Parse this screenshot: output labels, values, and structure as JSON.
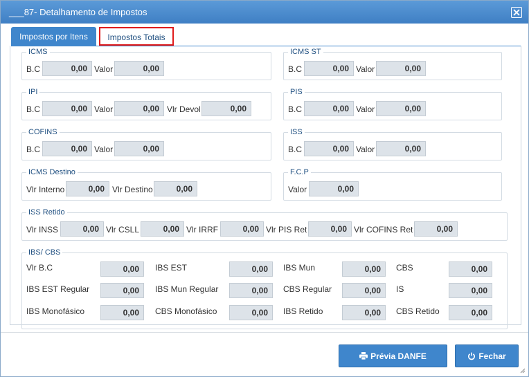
{
  "window": {
    "title": "___87- Detalhamento de Impostos"
  },
  "tabs": [
    {
      "label": "Impostos por Itens",
      "active": true
    },
    {
      "label": "Impostos Totais",
      "active": false
    }
  ],
  "labels": {
    "bc": "B.C",
    "valor": "Valor",
    "vlr_devol": "Vlr Devol"
  },
  "icms": {
    "title": "ICMS",
    "bc": "0,00",
    "valor": "0,00"
  },
  "icms_st": {
    "title": "ICMS ST",
    "bc": "0,00",
    "valor": "0,00"
  },
  "ipi": {
    "title": "IPI",
    "bc": "0,00",
    "valor": "0,00",
    "vlr_devol": "0,00"
  },
  "pis": {
    "title": "PIS",
    "bc": "0,00",
    "valor": "0,00"
  },
  "cofins": {
    "title": "COFINS",
    "bc": "0,00",
    "valor": "0,00"
  },
  "iss": {
    "title": "ISS",
    "bc": "0,00",
    "valor": "0,00"
  },
  "icms_destino": {
    "title": "ICMS Destino",
    "vlr_interno_label": "Vlr Interno",
    "vlr_interno": "0,00",
    "vlr_destino_label": "Vlr Destino",
    "vlr_destino": "0,00"
  },
  "fcp": {
    "title": "F.C.P",
    "valor_label": "Valor",
    "valor": "0,00"
  },
  "iss_retido": {
    "title": "ISS Retido",
    "fields": [
      {
        "label": "Vlr INSS",
        "value": "0,00"
      },
      {
        "label": "Vlr CSLL",
        "value": "0,00"
      },
      {
        "label": "Vlr IRRF",
        "value": "0,00"
      },
      {
        "label": "Vlr PIS Ret",
        "value": "0,00"
      },
      {
        "label": "Vlr COFINS Ret",
        "value": "0,00"
      }
    ]
  },
  "ibs_cbs": {
    "title": "IBS/ CBS",
    "fields": [
      {
        "label": "Vlr B.C",
        "value": "0,00"
      },
      {
        "label": "IBS EST",
        "value": "0,00"
      },
      {
        "label": "IBS Mun",
        "value": "0,00"
      },
      {
        "label": "CBS",
        "value": "0,00"
      },
      {
        "label": "IBS EST Regular",
        "value": "0,00"
      },
      {
        "label": "IBS Mun Regular",
        "value": "0,00"
      },
      {
        "label": "CBS Regular",
        "value": "0,00"
      },
      {
        "label": "IS",
        "value": "0,00"
      },
      {
        "label": "IBS Monofásico",
        "value": "0,00"
      },
      {
        "label": "CBS Monofásico",
        "value": "0,00"
      },
      {
        "label": "IBS Retido",
        "value": "0,00"
      },
      {
        "label": "CBS Retido",
        "value": "0,00"
      }
    ]
  },
  "buttons": {
    "previa": "Prévia DANFE",
    "fechar": "Fechar"
  },
  "colors": {
    "accent": "#3f86cc",
    "tab_highlight": "#e01b1b",
    "field_bg": "#dde3e9"
  }
}
